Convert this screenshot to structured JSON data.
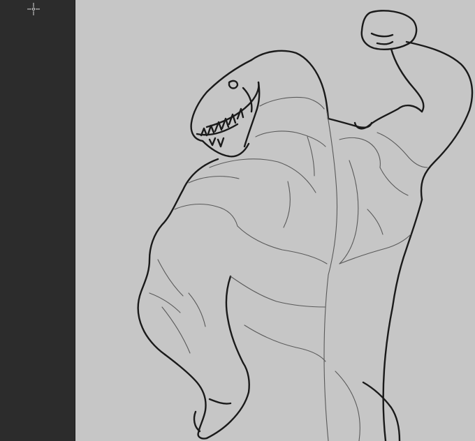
{
  "icons": {
    "cursor": "crosshair-cursor-icon"
  },
  "colors": {
    "panel": "#2c2c2c",
    "canvas": "#c6c6c6",
    "ink": "#1a1a1a",
    "sketch": "#5a5a5a",
    "cursor": "#d8d8d8"
  }
}
